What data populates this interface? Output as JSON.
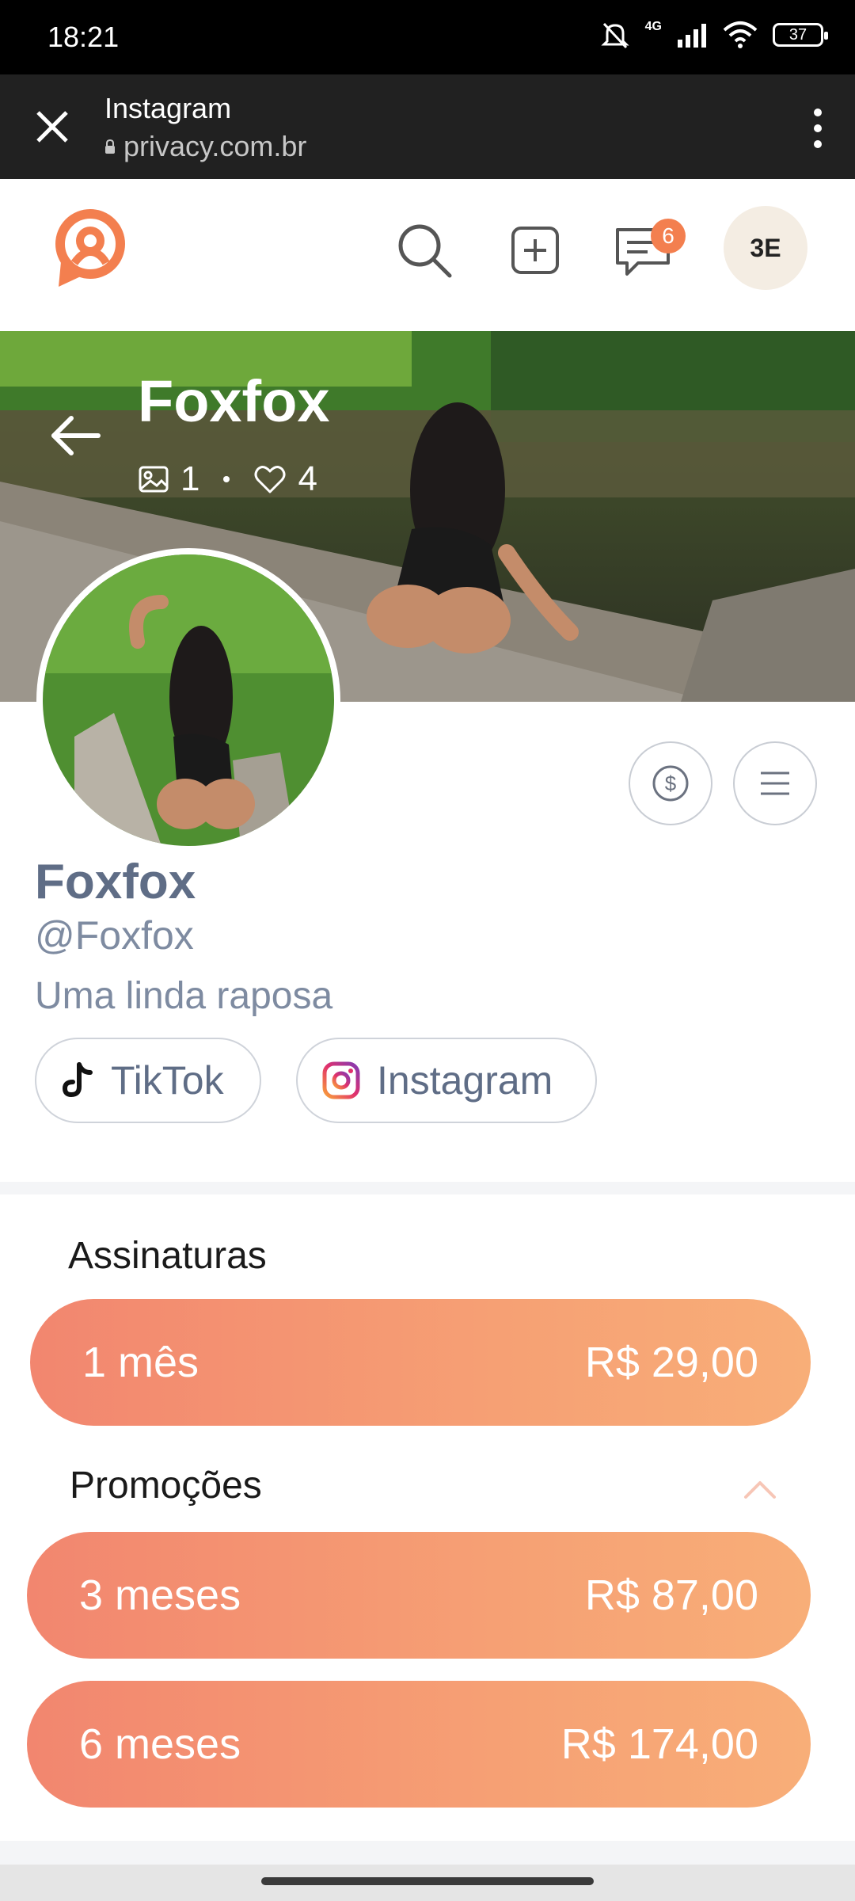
{
  "status_bar": {
    "time": "18:21",
    "network": "4G",
    "battery": "37"
  },
  "browser_tab": {
    "title": "Instagram",
    "url": "privacy.com.br"
  },
  "header": {
    "messages_badge": "6",
    "avatar_initials": "3E",
    "accent_color": "#f37f4f"
  },
  "cover": {
    "title": "Foxfox",
    "media_count": "1",
    "likes_count": "4"
  },
  "profile": {
    "name": "Foxfox",
    "handle": "@Foxfox",
    "bio": "Uma linda raposa"
  },
  "social_links": [
    {
      "label": "TikTok",
      "icon": "tiktok-icon"
    },
    {
      "label": "Instagram",
      "icon": "instagram-icon"
    }
  ],
  "subscriptions": {
    "title": "Assinaturas",
    "plans": [
      {
        "duration": "1 mês",
        "price": "R$ 29,00"
      }
    ]
  },
  "promotions": {
    "title": "Promoções",
    "plans": [
      {
        "duration": "3 meses",
        "price": "R$ 87,00"
      },
      {
        "duration": "6 meses",
        "price": "R$ 174,00"
      }
    ]
  },
  "plan_gradient": [
    "#f2866f",
    "#f8ae78"
  ]
}
